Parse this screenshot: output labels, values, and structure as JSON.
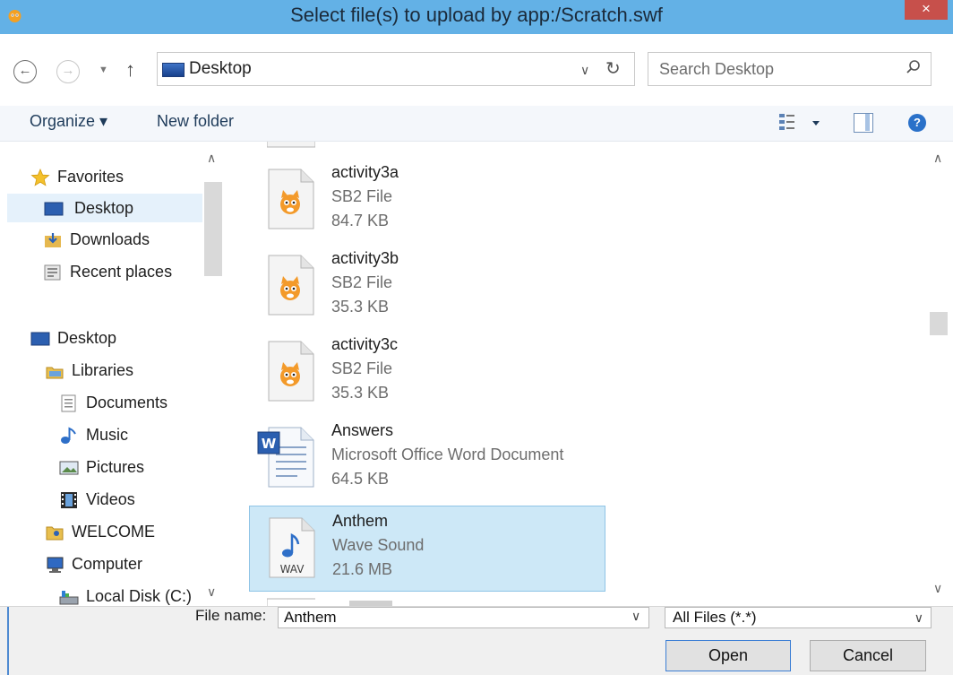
{
  "window": {
    "title": "Select file(s) to upload by app:/Scratch.swf",
    "close_label": "×"
  },
  "address": {
    "location": "Desktop",
    "search_placeholder": "Search Desktop"
  },
  "toolbar": {
    "organize_label": "Organize ▾",
    "new_folder_label": "New folder",
    "help_label": "?"
  },
  "nav": {
    "items": [
      {
        "label": "Favorites",
        "icon": "star-icon"
      },
      {
        "label": "Desktop",
        "icon": "desktop-icon",
        "selected": true
      },
      {
        "label": "Downloads",
        "icon": "downloads-icon"
      },
      {
        "label": "Recent places",
        "icon": "recent-places-icon"
      },
      {
        "label": "Desktop",
        "icon": "desktop-icon"
      },
      {
        "label": "Libraries",
        "icon": "libraries-icon"
      },
      {
        "label": "Documents",
        "icon": "document-icon"
      },
      {
        "label": "Music",
        "icon": "music-icon"
      },
      {
        "label": "Pictures",
        "icon": "pictures-icon"
      },
      {
        "label": "Videos",
        "icon": "videos-icon"
      },
      {
        "label": "WELCOME",
        "icon": "user-folder-icon"
      },
      {
        "label": "Computer",
        "icon": "computer-icon"
      },
      {
        "label": "Local Disk (C:)",
        "icon": "disk-icon"
      }
    ]
  },
  "files": [
    {
      "name": "activity3a",
      "type": "SB2 File",
      "size": "84.7 KB",
      "icon": "scratch-file-icon"
    },
    {
      "name": "activity3b",
      "type": "SB2 File",
      "size": "35.3 KB",
      "icon": "scratch-file-icon"
    },
    {
      "name": "activity3c",
      "type": "SB2 File",
      "size": "35.3 KB",
      "icon": "scratch-file-icon"
    },
    {
      "name": "Answers",
      "type": "Microsoft Office Word Document",
      "size": "64.5 KB",
      "icon": "word-document-icon"
    },
    {
      "name": "Anthem",
      "type": "Wave Sound",
      "size": "21.6 MB",
      "icon": "wav-file-icon",
      "selected": true,
      "icon_text": "WAV"
    }
  ],
  "bottom": {
    "file_name_label": "File name:",
    "file_name_value": "Anthem",
    "file_type_value": "All Files (*.*)",
    "open_label": "Open",
    "cancel_label": "Cancel"
  },
  "colors": {
    "title_bar": "#63b1e6",
    "selection": "#cde8f7",
    "close_button": "#c7504b"
  }
}
